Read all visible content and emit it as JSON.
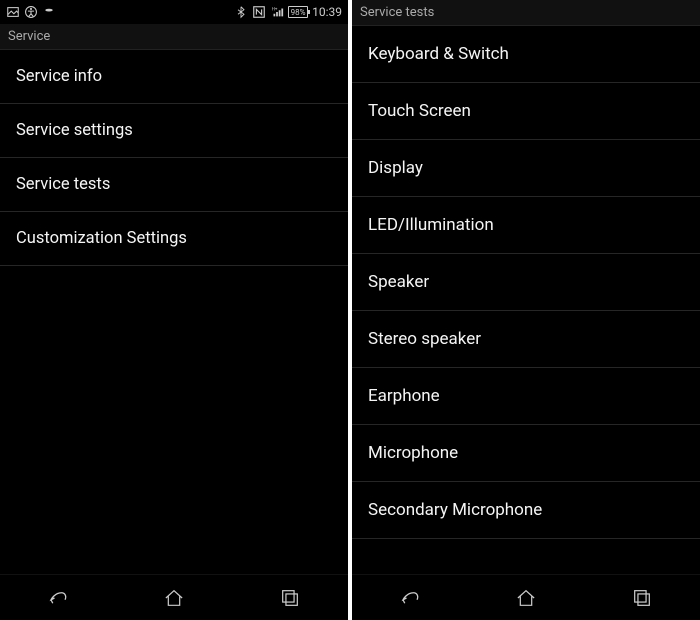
{
  "status": {
    "battery_percent": "98%",
    "time": "10:39"
  },
  "left": {
    "header": "Service",
    "items": [
      "Service info",
      "Service settings",
      "Service tests",
      "Customization Settings"
    ]
  },
  "right": {
    "header": "Service tests",
    "items": [
      "Keyboard & Switch",
      "Touch Screen",
      "Display",
      "LED/Illumination",
      "Speaker",
      "Stereo speaker",
      "Earphone",
      "Microphone",
      "Secondary Microphone"
    ]
  }
}
